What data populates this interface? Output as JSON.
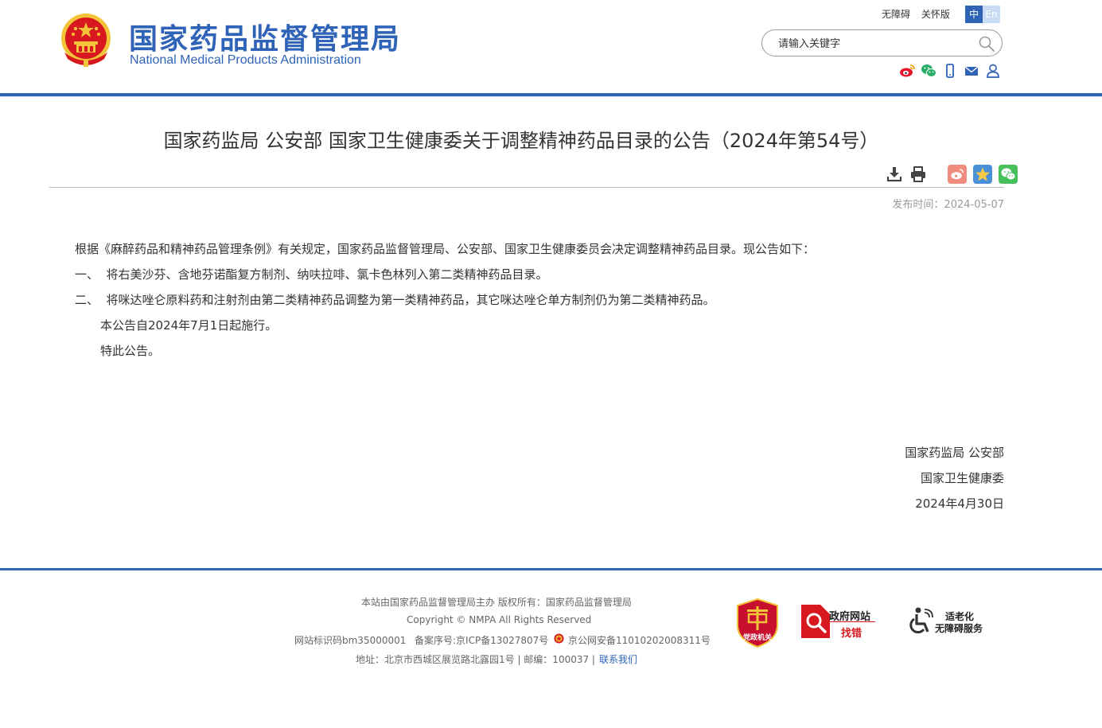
{
  "header": {
    "site_name_cn": "国家药品监督管理局",
    "site_name_en": "National Medical Products Administration",
    "top_links": [
      "无障碍",
      "关怀版"
    ],
    "lang": {
      "zh": "中",
      "en": "En"
    },
    "search_placeholder": "请输入关键字",
    "social_icons": [
      "weibo-icon",
      "wechat-icon",
      "mobile-icon",
      "mail-icon",
      "user-icon"
    ]
  },
  "article": {
    "title": "国家药监局 公安部 国家卫生健康委关于调整精神药品目录的公告（2024年第54号）",
    "tools": [
      "download-icon",
      "print-icon"
    ],
    "share": [
      "weibo-share-icon",
      "qzone-share-icon",
      "wechat-share-icon"
    ],
    "publish_label": "发布时间：",
    "publish_date": "2024-05-07",
    "paragraphs": [
      "根据《麻醉药品和精神药品管理条例》有关规定，国家药品监督管理局、公安部、国家卫生健康委员会决定调整精神药品目录。现公告如下：",
      "一、  将右美沙芬、含地芬诺酯复方制剂、纳呋拉啡、氯卡色林列入第二类精神药品目录。",
      "二、  将咪达唑仑原料药和注射剂由第二类精神药品调整为第一类精神药品，其它咪达唑仑单方制剂仍为第二类精神药品。",
      "本公告自2024年7月1日起施行。",
      "特此公告。"
    ],
    "signature": [
      "国家药监局 公安部",
      "国家卫生健康委",
      "2024年4月30日"
    ]
  },
  "footer": {
    "line1": "本站由国家药品监督管理局主办 版权所有：国家药品监督管理局",
    "line2": "Copyright © NMPA All Rights Reserved",
    "site_id": "网站标识码bm35000001",
    "icp": "备案序号:京ICP备13027807号",
    "police": "京公网安备11010202008311号",
    "address": "地址：北京市西城区展览路北露园1号 | 邮编：100037 |",
    "contact": "联系我们",
    "badge_party_text": "党政机关",
    "badge_error_text": [
      "政府网站",
      "找错"
    ],
    "badge_access_text": [
      "适老化",
      "无障碍服务"
    ]
  },
  "colors": {
    "brand_blue": "#2f63b8",
    "emblem_red": "#d7191f",
    "gold": "#f3c33a"
  }
}
